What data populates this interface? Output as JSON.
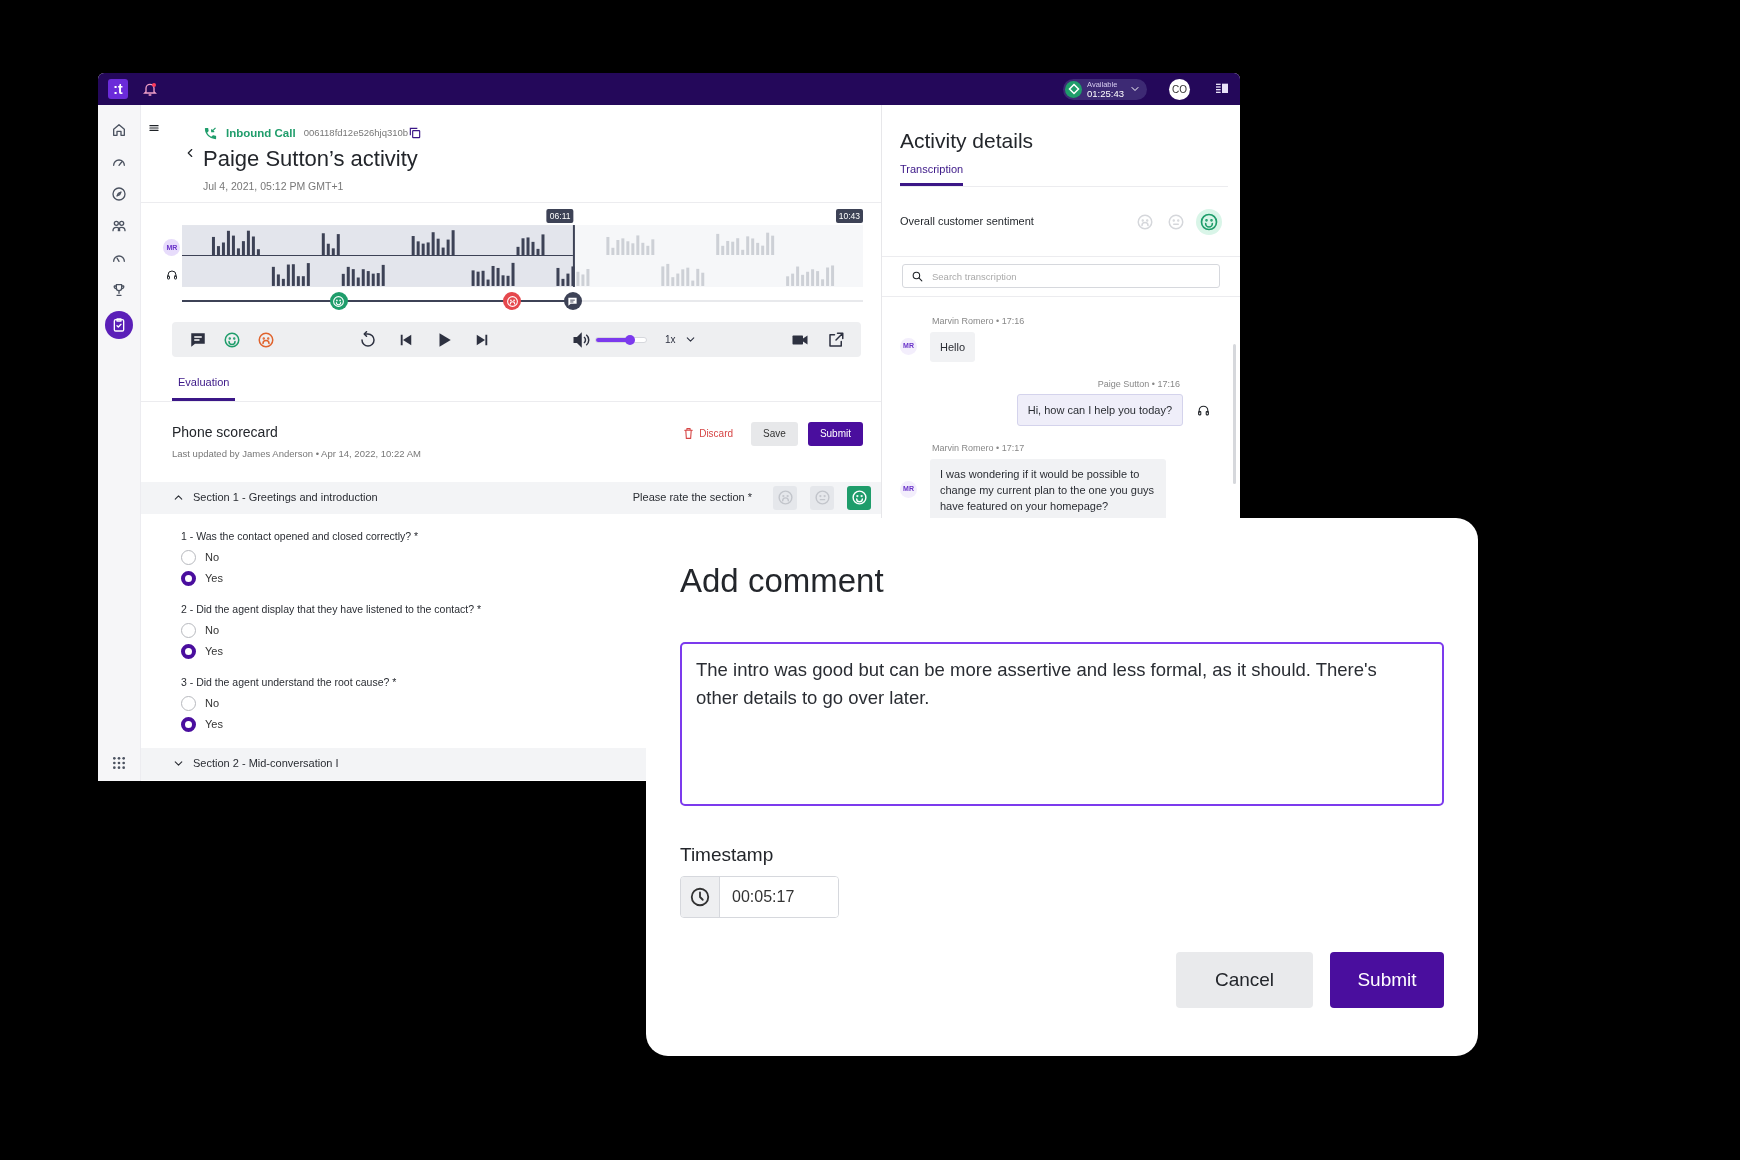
{
  "topbar": {
    "logo": ":t",
    "status": {
      "label": "Available",
      "time": "01:25:43"
    },
    "avatar": "CO"
  },
  "sidebar": {
    "items": [
      {
        "selected": false
      },
      {
        "selected": false
      },
      {
        "selected": false
      },
      {
        "selected": false
      },
      {
        "selected": false
      },
      {
        "selected": false
      },
      {
        "selected": true
      }
    ]
  },
  "call": {
    "type": "Inbound Call",
    "id": "006118fd12e526hjq310b",
    "title": "Paige Sutton’s activity",
    "date": "Jul 4, 2021, 05:12 PM GMT+1"
  },
  "player": {
    "speaker": "MR",
    "current": "06:11",
    "total": "10:43",
    "level": 0.574,
    "markers": [
      {
        "kind": "positive"
      },
      {
        "kind": "negative"
      },
      {
        "kind": "comment"
      }
    ],
    "volume": {
      "level": 0.68
    },
    "speed": "1x"
  },
  "tabs": [
    {
      "label": "Evaluation",
      "selected": true
    }
  ],
  "scorecard": {
    "title": "Phone scorecard",
    "meta": "Last updated by James Anderson • Apr 14, 2022, 10:22 AM",
    "discard": "Discard",
    "save": "Save",
    "submit": "Submit"
  },
  "sections": [
    {
      "title": "Section 1 - Greetings and introduction",
      "expanded": true,
      "rate_label": "Please rate the section *",
      "rating": [
        {
          "selected": false
        },
        {
          "selected": false
        },
        {
          "selected": true
        }
      ],
      "questions": [
        {
          "text": "1 - Was the contact opened and closed correctly? *",
          "options": [
            {
              "label": "No",
              "selected": false
            },
            {
              "label": "Yes",
              "selected": true
            }
          ]
        },
        {
          "text": "2 - Did the agent display that they have listened to the contact? *",
          "options": [
            {
              "label": "No",
              "selected": false
            },
            {
              "label": "Yes",
              "selected": true
            }
          ]
        },
        {
          "text": "3 - Did the agent understand the root cause? *",
          "options": [
            {
              "label": "No",
              "selected": false
            },
            {
              "label": "Yes",
              "selected": true
            }
          ]
        }
      ]
    },
    {
      "title": "Section 2 - Mid-conversation I",
      "expanded": false
    }
  ],
  "activity": {
    "title": "Activity details",
    "tabs": [
      {
        "label": "Transcription",
        "selected": true
      }
    ],
    "sentiment_label": "Overall customer sentiment",
    "sentiments": [
      {
        "selected": false
      },
      {
        "selected": false
      },
      {
        "selected": true
      }
    ],
    "search_placeholder": "Search transcription",
    "messages": [
      {
        "kind": "customer",
        "meta": "Marvin Romero • 17:16",
        "avatar": "MR",
        "text": "Hello"
      },
      {
        "kind": "agent",
        "meta": "Paige Sutton • 17:16",
        "text": "Hi, how can I help you today?"
      },
      {
        "kind": "customer",
        "meta": "Marvin Romero • 17:17",
        "avatar": "MR",
        "text": "I was wondering if it would be possible to change my current plan to the one you guys have featured on your homepage?"
      }
    ]
  },
  "dialog": {
    "title": "Add comment",
    "comment": "The intro was good but can be more assertive and less formal, as it should. There's other details to go over later.",
    "timestamp_label": "Timestamp",
    "timestamp": "00:05:17",
    "cancel": "Cancel",
    "submit": "Submit"
  }
}
